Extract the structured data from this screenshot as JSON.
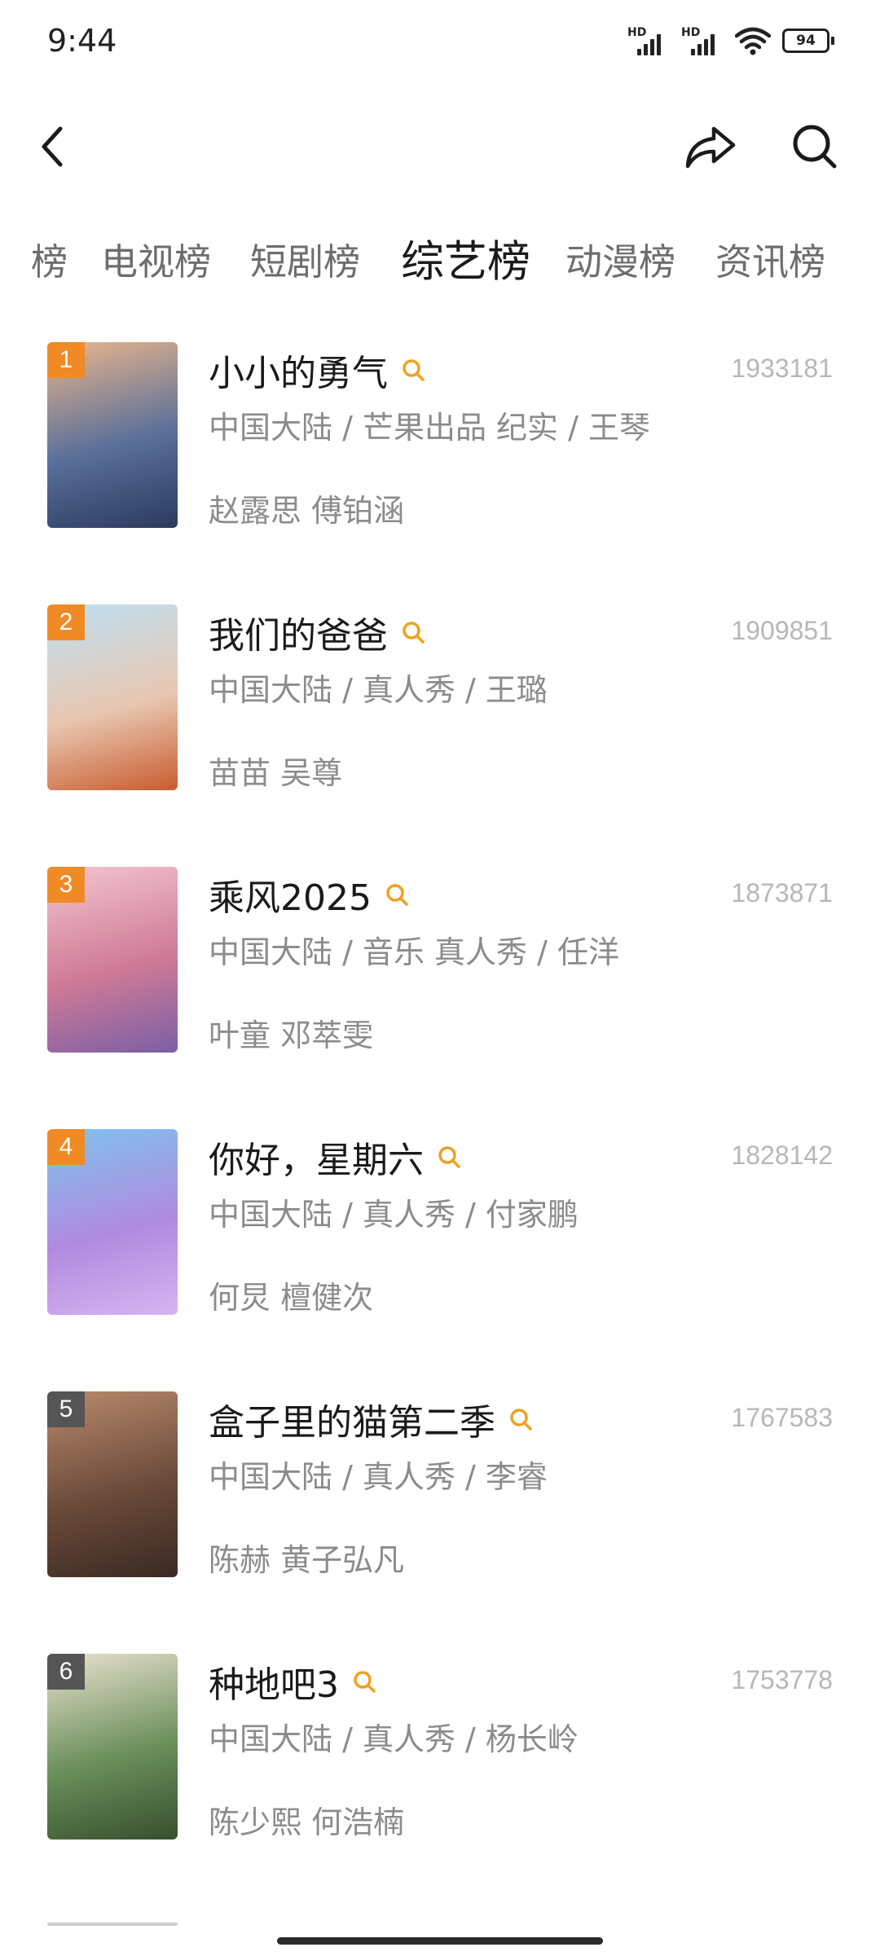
{
  "status": {
    "time": "9:44",
    "battery": "94",
    "hd1": "HD",
    "hd2": "HD"
  },
  "icons": {
    "back": "back-arrow-icon",
    "share": "share-icon",
    "search": "search-icon"
  },
  "tabs": [
    "榜",
    "电视榜",
    "短剧榜",
    "综艺榜",
    "动漫榜",
    "资讯榜"
  ],
  "active_tab_index": 3,
  "colors": {
    "accent_search": "#f0a020",
    "rank_top": "#f08a24",
    "rank_other": "#555555"
  },
  "items": [
    {
      "rank": "1",
      "title": "小小的勇气",
      "score": "1933181",
      "meta": "中国大陆 / 芒果出品 纪实 / 王琴",
      "cast": "赵露思 傅铂涵",
      "poster_colors": [
        "#e9b58c",
        "#5a6f9a",
        "#2c3a5e"
      ]
    },
    {
      "rank": "2",
      "title": "我们的爸爸",
      "score": "1909851",
      "meta": "中国大陆 / 真人秀 / 王璐",
      "cast": "苗苗 吴尊",
      "poster_colors": [
        "#bfe0f3",
        "#e8c7b2",
        "#c95c2f"
      ]
    },
    {
      "rank": "3",
      "title": "乘风2025",
      "score": "1873871",
      "meta": "中国大陆 / 音乐 真人秀 / 任洋",
      "cast": "叶童 邓萃雯",
      "poster_colors": [
        "#f3c5cf",
        "#cf7a96",
        "#7b5fa6"
      ]
    },
    {
      "rank": "4",
      "title": "你好，星期六",
      "score": "1828142",
      "meta": "中国大陆 / 真人秀 / 付家鹏",
      "cast": "何炅 檀健次",
      "poster_colors": [
        "#7fc3ee",
        "#b08adf",
        "#d6b4f0"
      ]
    },
    {
      "rank": "5",
      "title": "盒子里的猫第二季",
      "score": "1767583",
      "meta": "中国大陆 / 真人秀 / 李睿",
      "cast": "陈赫 黄子弘凡",
      "poster_colors": [
        "#b88a6c",
        "#6b4a3a",
        "#3a2a23"
      ]
    },
    {
      "rank": "6",
      "title": "种地吧3",
      "score": "1753778",
      "meta": "中国大陆 / 真人秀 / 杨长岭",
      "cast": "陈少熙 何浩楠",
      "poster_colors": [
        "#e9e1cf",
        "#6b8f5b",
        "#37502f"
      ]
    }
  ]
}
